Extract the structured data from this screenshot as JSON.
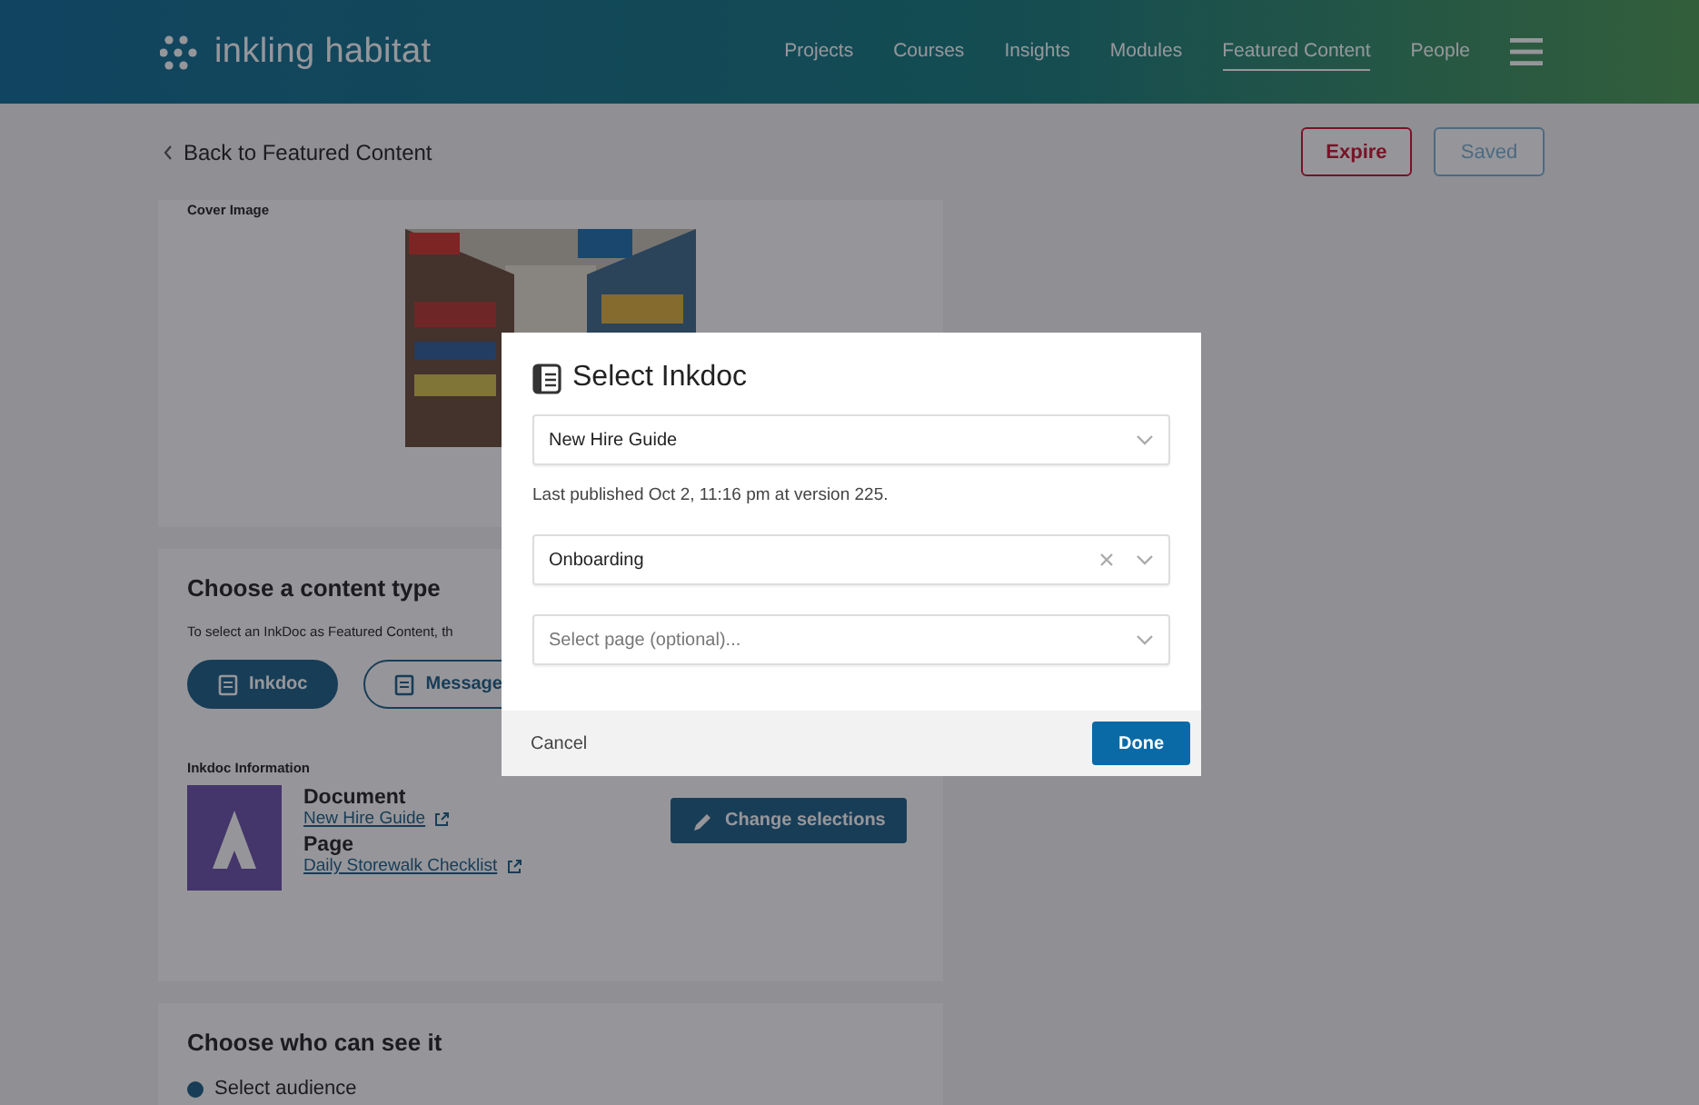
{
  "app": {
    "logo": "inkling habitat"
  },
  "nav": [
    {
      "label": "Projects",
      "selected": false
    },
    {
      "label": "Courses",
      "selected": false
    },
    {
      "label": "Insights",
      "selected": false
    },
    {
      "label": "Modules",
      "selected": false
    },
    {
      "label": "Featured Content",
      "selected": true
    },
    {
      "label": "People",
      "selected": false
    }
  ],
  "toolbar": {
    "back": "Back to Featured Content",
    "buttons": [
      {
        "label": "Expire",
        "kind": "danger"
      },
      {
        "label": "Saved",
        "kind": "disabled"
      }
    ]
  },
  "cover": {
    "label": "Cover Image"
  },
  "content_type": {
    "title": "Choose a content type",
    "hint": "To select an InkDoc as Featured Content, th",
    "options": [
      {
        "label": "Inkdoc",
        "selected": true
      },
      {
        "label": "Message",
        "selected": false
      }
    ],
    "info_label": "Inkdoc Information",
    "document_label": "Document",
    "document": "New Hire Guide",
    "page_label": "Page",
    "page": "Daily Storewalk Checklist",
    "change_button": "Change selections"
  },
  "audience": {
    "title": "Choose who can see it",
    "options": [
      {
        "label": "Select audience",
        "selected": true
      }
    ]
  },
  "dialog": {
    "title": "Select Inkdoc",
    "fields": [
      {
        "value": "New Hire Guide",
        "clearable": false,
        "note": "Last published Oct 2, 11:16 pm at version 225."
      },
      {
        "value": "Onboarding",
        "clearable": true
      },
      {
        "placeholder": "Select page (optional)...",
        "clearable": false
      }
    ],
    "cancel": "Cancel",
    "done": "Done"
  }
}
